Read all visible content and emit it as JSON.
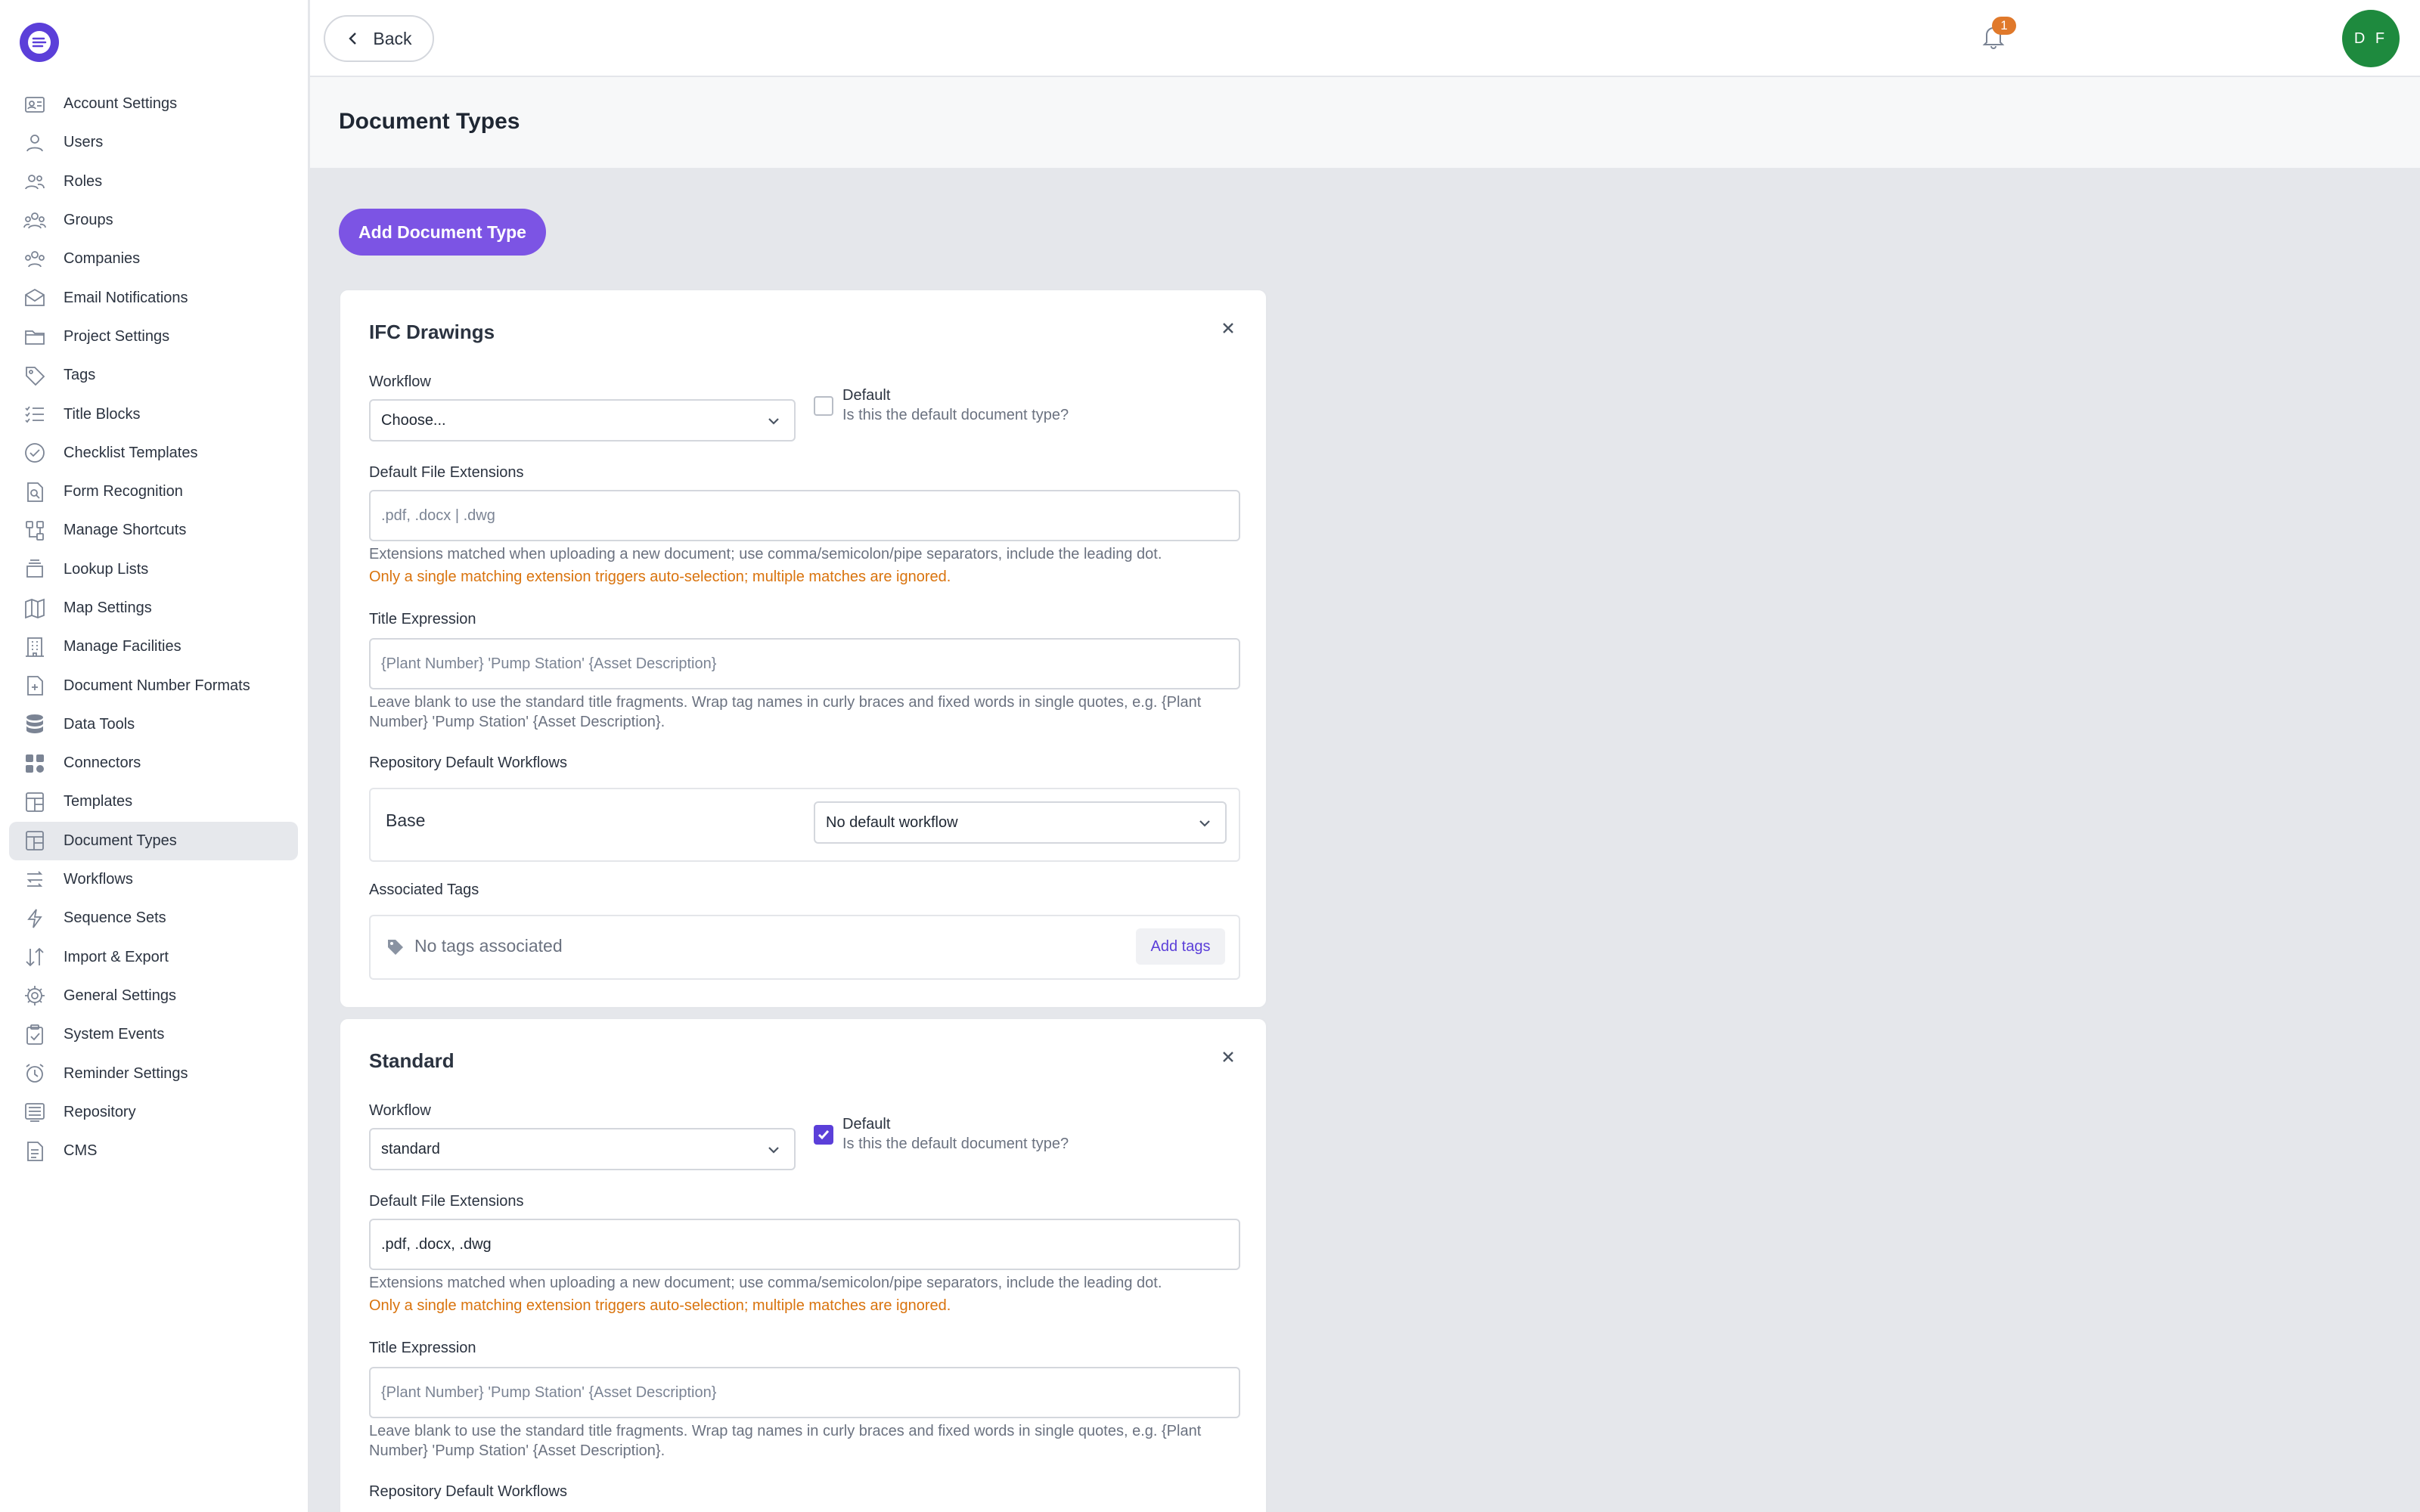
{
  "sidebar": {
    "items": [
      {
        "label": "Account Settings",
        "icon": "account-settings-icon"
      },
      {
        "label": "Users",
        "icon": "user-icon"
      },
      {
        "label": "Roles",
        "icon": "roles-icon"
      },
      {
        "label": "Groups",
        "icon": "groups-icon"
      },
      {
        "label": "Companies",
        "icon": "companies-icon"
      },
      {
        "label": "Email Notifications",
        "icon": "envelope-icon"
      },
      {
        "label": "Project Settings",
        "icon": "folder-icon"
      },
      {
        "label": "Tags",
        "icon": "tag-icon"
      },
      {
        "label": "Title Blocks",
        "icon": "checklist-icon"
      },
      {
        "label": "Checklist Templates",
        "icon": "check-circle-icon"
      },
      {
        "label": "Form Recognition",
        "icon": "document-search-icon"
      },
      {
        "label": "Manage Shortcuts",
        "icon": "shortcut-icon"
      },
      {
        "label": "Lookup Lists",
        "icon": "stack-icon"
      },
      {
        "label": "Map Settings",
        "icon": "map-icon"
      },
      {
        "label": "Manage Facilities",
        "icon": "building-icon"
      },
      {
        "label": "Document Number Formats",
        "icon": "document-plus-icon"
      },
      {
        "label": "Data Tools",
        "icon": "database-icon"
      },
      {
        "label": "Connectors",
        "icon": "connectors-icon"
      },
      {
        "label": "Templates",
        "icon": "template-icon"
      },
      {
        "label": "Document Types",
        "icon": "document-types-icon"
      },
      {
        "label": "Workflows",
        "icon": "workflow-icon"
      },
      {
        "label": "Sequence Sets",
        "icon": "sequence-icon"
      },
      {
        "label": "Import & Export",
        "icon": "import-export-icon"
      },
      {
        "label": "General Settings",
        "icon": "gear-icon"
      },
      {
        "label": "System Events",
        "icon": "clipboard-check-icon"
      },
      {
        "label": "Reminder Settings",
        "icon": "alarm-icon"
      },
      {
        "label": "Repository",
        "icon": "repository-icon"
      },
      {
        "label": "CMS",
        "icon": "cms-icon"
      }
    ],
    "active_index": 19
  },
  "topbar": {
    "back_label": "Back",
    "notification_count": "1",
    "avatar_initials": "D F"
  },
  "page": {
    "title": "Document Types",
    "add_button": "Add Document Type"
  },
  "cards": [
    {
      "title": "IFC Drawings",
      "workflow_label": "Workflow",
      "workflow_value": "Choose...",
      "default_label": "Default",
      "default_sub": "Is this the default document type?",
      "default_checked": false,
      "ext_label": "Default File Extensions",
      "ext_placeholder": ".pdf, .docx | .dwg",
      "ext_value": "",
      "ext_help": "Extensions matched when uploading a new document; use comma/semicolon/pipe separators, include the leading dot.",
      "ext_warn": "Only a single matching extension triggers auto-selection; multiple matches are ignored.",
      "title_expr_label": "Title Expression",
      "title_expr_placeholder": "{Plant Number} 'Pump Station' {Asset Description}",
      "title_expr_help": "Leave blank to use the standard title fragments. Wrap tag names in curly braces and fixed words in single quotes, e.g. {Plant Number} 'Pump Station' {Asset Description}.",
      "repo_label": "Repository Default Workflows",
      "repo_name": "Base",
      "repo_value": "No default workflow",
      "tags_label": "Associated Tags",
      "no_tags": "No tags associated",
      "add_tags": "Add tags"
    },
    {
      "title": "Standard",
      "workflow_label": "Workflow",
      "workflow_value": "standard",
      "default_label": "Default",
      "default_sub": "Is this the default document type?",
      "default_checked": true,
      "ext_label": "Default File Extensions",
      "ext_value": ".pdf, .docx, .dwg",
      "ext_help": "Extensions matched when uploading a new document; use comma/semicolon/pipe separators, include the leading dot.",
      "ext_warn": "Only a single matching extension triggers auto-selection; multiple matches are ignored.",
      "title_expr_label": "Title Expression",
      "title_expr_placeholder": "{Plant Number} 'Pump Station' {Asset Description}",
      "title_expr_help": "Leave blank to use the standard title fragments. Wrap tag names in curly braces and fixed words in single quotes, e.g. {Plant Number} 'Pump Station' {Asset Description}.",
      "repo_label": "Repository Default Workflows"
    }
  ],
  "colors": {
    "accent": "#7c54e4",
    "brand": "#5b3fd9",
    "warning": "#d9730d",
    "avatar": "#1e8a3e",
    "badge": "#e0792b"
  }
}
